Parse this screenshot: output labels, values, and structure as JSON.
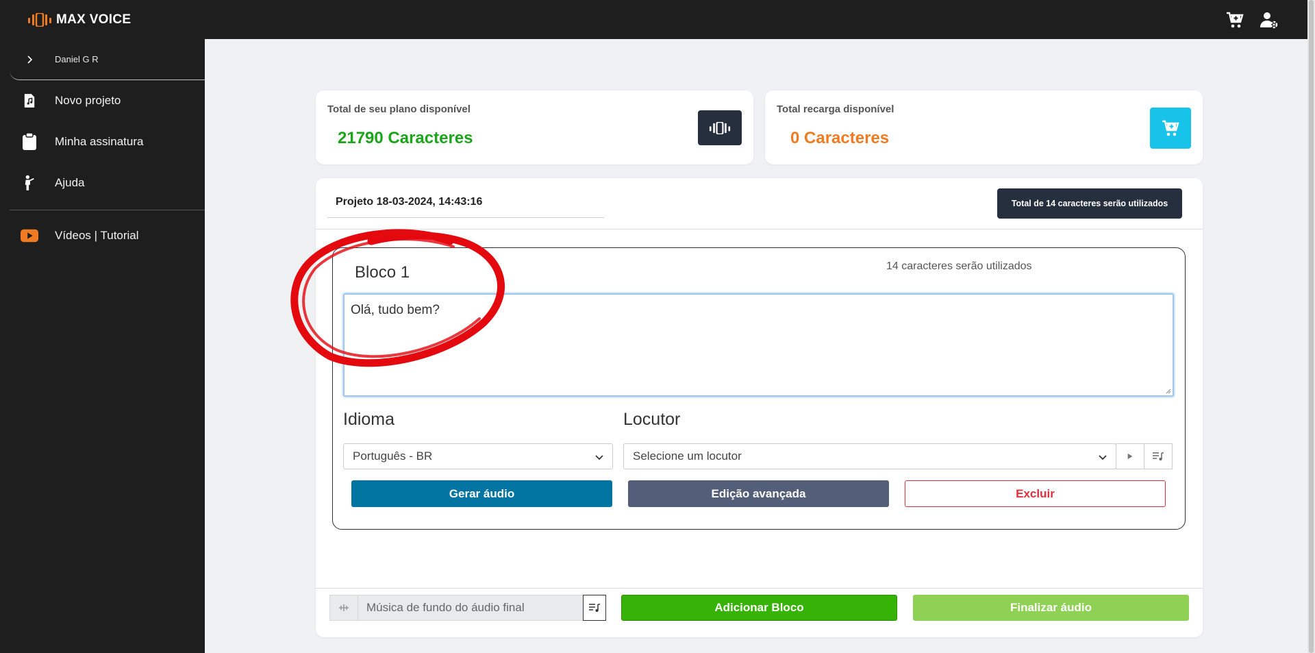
{
  "app": {
    "brand": "MAX VOICE",
    "brand_color": "#f07b22"
  },
  "topbar": {
    "icons": [
      "cart-plus-icon",
      "user-settings-icon"
    ]
  },
  "sidebar": {
    "user": "Daniel G R",
    "items": [
      {
        "label": "Novo projeto",
        "icon": "music-file-icon"
      },
      {
        "label": "Minha assinatura",
        "icon": "clipboard-icon"
      },
      {
        "label": "Ajuda",
        "icon": "person-help-icon"
      },
      {
        "label": "Vídeos | Tutorial",
        "icon": "youtube-play-icon"
      }
    ]
  },
  "stats": {
    "plan_label": "Total de seu plano disponível",
    "plan_value": "21790 Caracteres",
    "plan_color": "#1aa51a",
    "recharge_label": "Total recarga disponível",
    "recharge_value": "0 Caracteres",
    "recharge_color": "#f07b22",
    "recharge_btn_color": "#17c3e8"
  },
  "project": {
    "title": "Projeto 18-03-2024, 14:43:16",
    "total_badge": "Total de 14 caracteres serão utilizados"
  },
  "block": {
    "title": "Bloco 1",
    "count": "14 caracteres serão utilizados",
    "text": "Olá, tudo bem?",
    "language_label": "Idioma",
    "language_value": "Português - BR",
    "speaker_label": "Locutor",
    "speaker_placeholder": "Selecione um locutor",
    "generate_btn": "Gerar áudio",
    "advanced_btn": "Edição avançada",
    "delete_btn": "Excluir"
  },
  "footer": {
    "music_placeholder": "Música de fundo do áudio final",
    "add_block_btn": "Adicionar Bloco",
    "finalize_btn": "Finalizar áudio"
  }
}
